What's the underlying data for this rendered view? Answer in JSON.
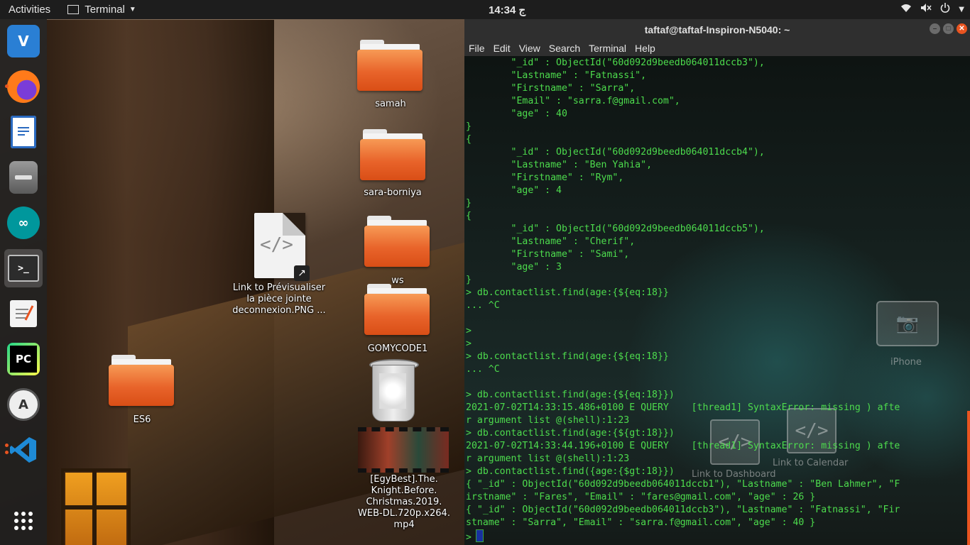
{
  "topbar": {
    "activities": "Activities",
    "app_name": "Terminal",
    "clock": "14:34 ج"
  },
  "dock": {
    "items": [
      {
        "name": "vnc-viewer",
        "label": "V"
      },
      {
        "name": "firefox",
        "label": ""
      },
      {
        "name": "libreoffice-writer",
        "label": ""
      },
      {
        "name": "file-cabinet",
        "label": ""
      },
      {
        "name": "arduino",
        "label": ""
      },
      {
        "name": "terminal",
        "label": ">_"
      },
      {
        "name": "text-editor",
        "label": ""
      },
      {
        "name": "pycharm",
        "label": "PC"
      },
      {
        "name": "software-updater",
        "label": "A"
      },
      {
        "name": "vscode",
        "label": ""
      },
      {
        "name": "show-applications",
        "label": ""
      }
    ]
  },
  "desktop": {
    "samah": "samah",
    "sara_borniya": "sara-borniya",
    "ws": "ws",
    "gomycode1": "GOMYCODE1",
    "es6": "ES6",
    "link_line1": "Link to Prévisualiser",
    "link_line2": "la pièce jointe",
    "link_line3": "deconnexion.PNG ...",
    "video_line1": "[EgyBest].The.",
    "video_line2": "Knight.Before.",
    "video_line3": "Christmas.2019.",
    "video_line4": "WEB-DL.720p.x264.",
    "video_line5": "mp4",
    "iphone": "iPhone",
    "link_dashboard": "Link to Dashboard",
    "link_calendar": "Link to Calendar"
  },
  "terminal": {
    "title": "taftaf@taftaf-Inspiron-N5040: ~",
    "menu": [
      "File",
      "Edit",
      "View",
      "Search",
      "Terminal",
      "Help"
    ],
    "lines": [
      "        \"_id\" : ObjectId(\"60d092d9beedb064011dccb3\"),",
      "        \"Lastname\" : \"Fatnassi\",",
      "        \"Firstname\" : \"Sarra\",",
      "        \"Email\" : \"sarra.f@gmail.com\",",
      "        \"age\" : 40",
      "}",
      "{",
      "        \"_id\" : ObjectId(\"60d092d9beedb064011dccb4\"),",
      "        \"Lastname\" : \"Ben Yahia\",",
      "        \"Firstname\" : \"Rym\",",
      "        \"age\" : 4",
      "}",
      "{",
      "        \"_id\" : ObjectId(\"60d092d9beedb064011dccb5\"),",
      "        \"Lastname\" : \"Cherif\",",
      "        \"Firstname\" : \"Sami\",",
      "        \"age\" : 3",
      "}",
      "> db.contactlist.find(age:{${eq:18}}",
      "... ^C",
      "",
      ">",
      ">",
      "> db.contactlist.find(age:{${eq:18}}",
      "... ^C",
      "",
      "> db.contactlist.find(age:{${eq:18}})",
      "2021-07-02T14:33:15.486+0100 E QUERY    [thread1] SyntaxError: missing ) afte",
      "r argument list @(shell):1:23",
      "> db.contactlist.find(age:{${gt:18}})",
      "2021-07-02T14:33:44.196+0100 E QUERY    [thread1] SyntaxError: missing ) afte",
      "r argument list @(shell):1:23",
      "> db.contactlist.find({age:{$gt:18}})",
      "{ \"_id\" : ObjectId(\"60d092d9beedb064011dccb1\"), \"Lastname\" : \"Ben Lahmer\", \"F",
      "irstname\" : \"Fares\", \"Email\" : \"fares@gmail.com\", \"age\" : 26 }",
      "{ \"_id\" : ObjectId(\"60d092d9beedb064011dccb3\"), \"Lastname\" : \"Fatnassi\", \"Fir",
      "stname\" : \"Sarra\", \"Email\" : \"sarra.f@gmail.com\", \"age\" : 40 }"
    ],
    "prompt": ">"
  },
  "colors": {
    "accent": "#e95420",
    "terminal_text": "#4ddc4d"
  }
}
